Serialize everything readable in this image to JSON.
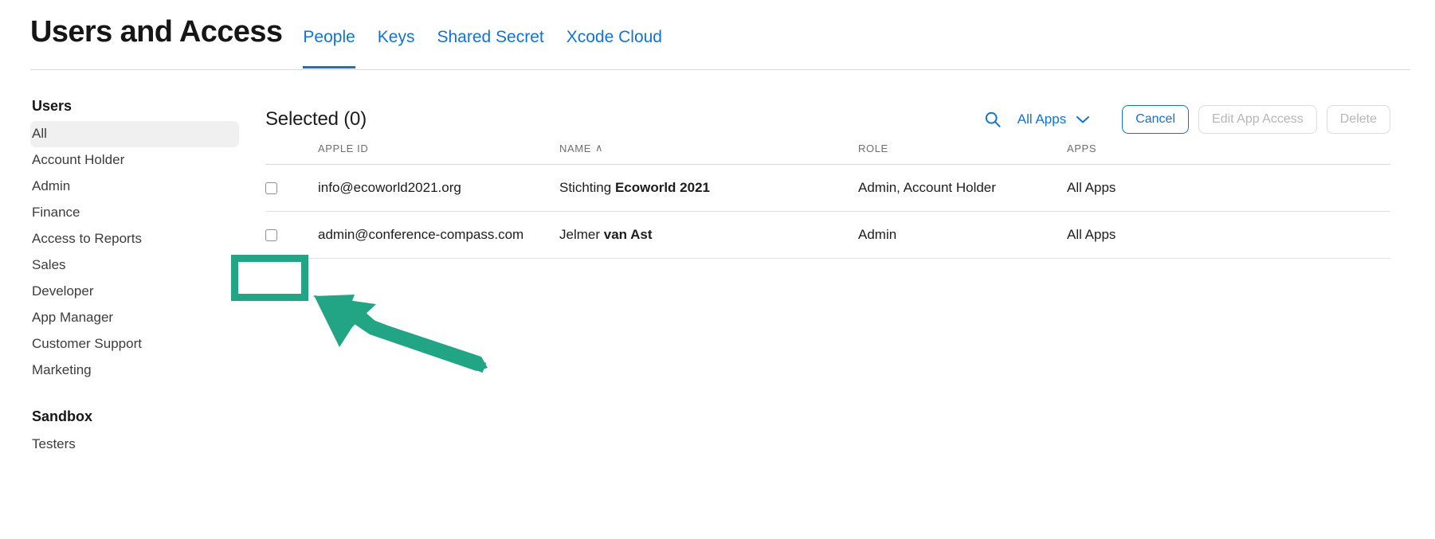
{
  "header": {
    "title": "Users and Access",
    "tabs": [
      {
        "label": "People",
        "active": true
      },
      {
        "label": "Keys",
        "active": false
      },
      {
        "label": "Shared Secret",
        "active": false
      },
      {
        "label": "Xcode Cloud",
        "active": false
      }
    ]
  },
  "sidebar": {
    "users_heading": "Users",
    "users_items": [
      {
        "label": "All",
        "selected": true
      },
      {
        "label": "Account Holder",
        "selected": false
      },
      {
        "label": "Admin",
        "selected": false
      },
      {
        "label": "Finance",
        "selected": false
      },
      {
        "label": "Access to Reports",
        "selected": false
      },
      {
        "label": "Sales",
        "selected": false
      },
      {
        "label": "Developer",
        "selected": false
      },
      {
        "label": "App Manager",
        "selected": false
      },
      {
        "label": "Customer Support",
        "selected": false
      },
      {
        "label": "Marketing",
        "selected": false
      }
    ],
    "sandbox_heading": "Sandbox",
    "sandbox_items": [
      {
        "label": "Testers",
        "selected": false
      }
    ]
  },
  "toolbar": {
    "selected_label": "Selected (0)",
    "search_icon": "search-icon",
    "apps_filter_label": "All Apps",
    "apps_filter_icon": "chevron-down-icon",
    "cancel_label": "Cancel",
    "edit_app_access_label": "Edit App Access",
    "delete_label": "Delete"
  },
  "table": {
    "columns": [
      {
        "key": "apple_id",
        "label": "Apple ID"
      },
      {
        "key": "name",
        "label": "Name",
        "sorted": "asc",
        "sort_glyph": "∧"
      },
      {
        "key": "role",
        "label": "Role"
      },
      {
        "key": "apps",
        "label": "Apps"
      }
    ],
    "rows": [
      {
        "checked": false,
        "apple_id": "info@ecoworld2021.org",
        "name_first": "Stichting",
        "name_last": "Ecoworld 2021",
        "role": "Admin, Account Holder",
        "apps": "All Apps"
      },
      {
        "checked": false,
        "apple_id": "admin@conference-compass.com",
        "name_first": "Jelmer",
        "name_last": "van Ast",
        "role": "Admin",
        "apps": "All Apps"
      }
    ]
  },
  "annotation": {
    "color": "#22a584",
    "target": "row-2-select-checkbox",
    "shape": "rectangle-with-arrow"
  },
  "colors": {
    "accent_blue": "#1273d6",
    "text_primary": "#1d1d1f",
    "text_secondary": "#6e6e73",
    "disabled": "#b6b6b6",
    "divider": "#d9d9d9",
    "annotation_green": "#22a584"
  }
}
